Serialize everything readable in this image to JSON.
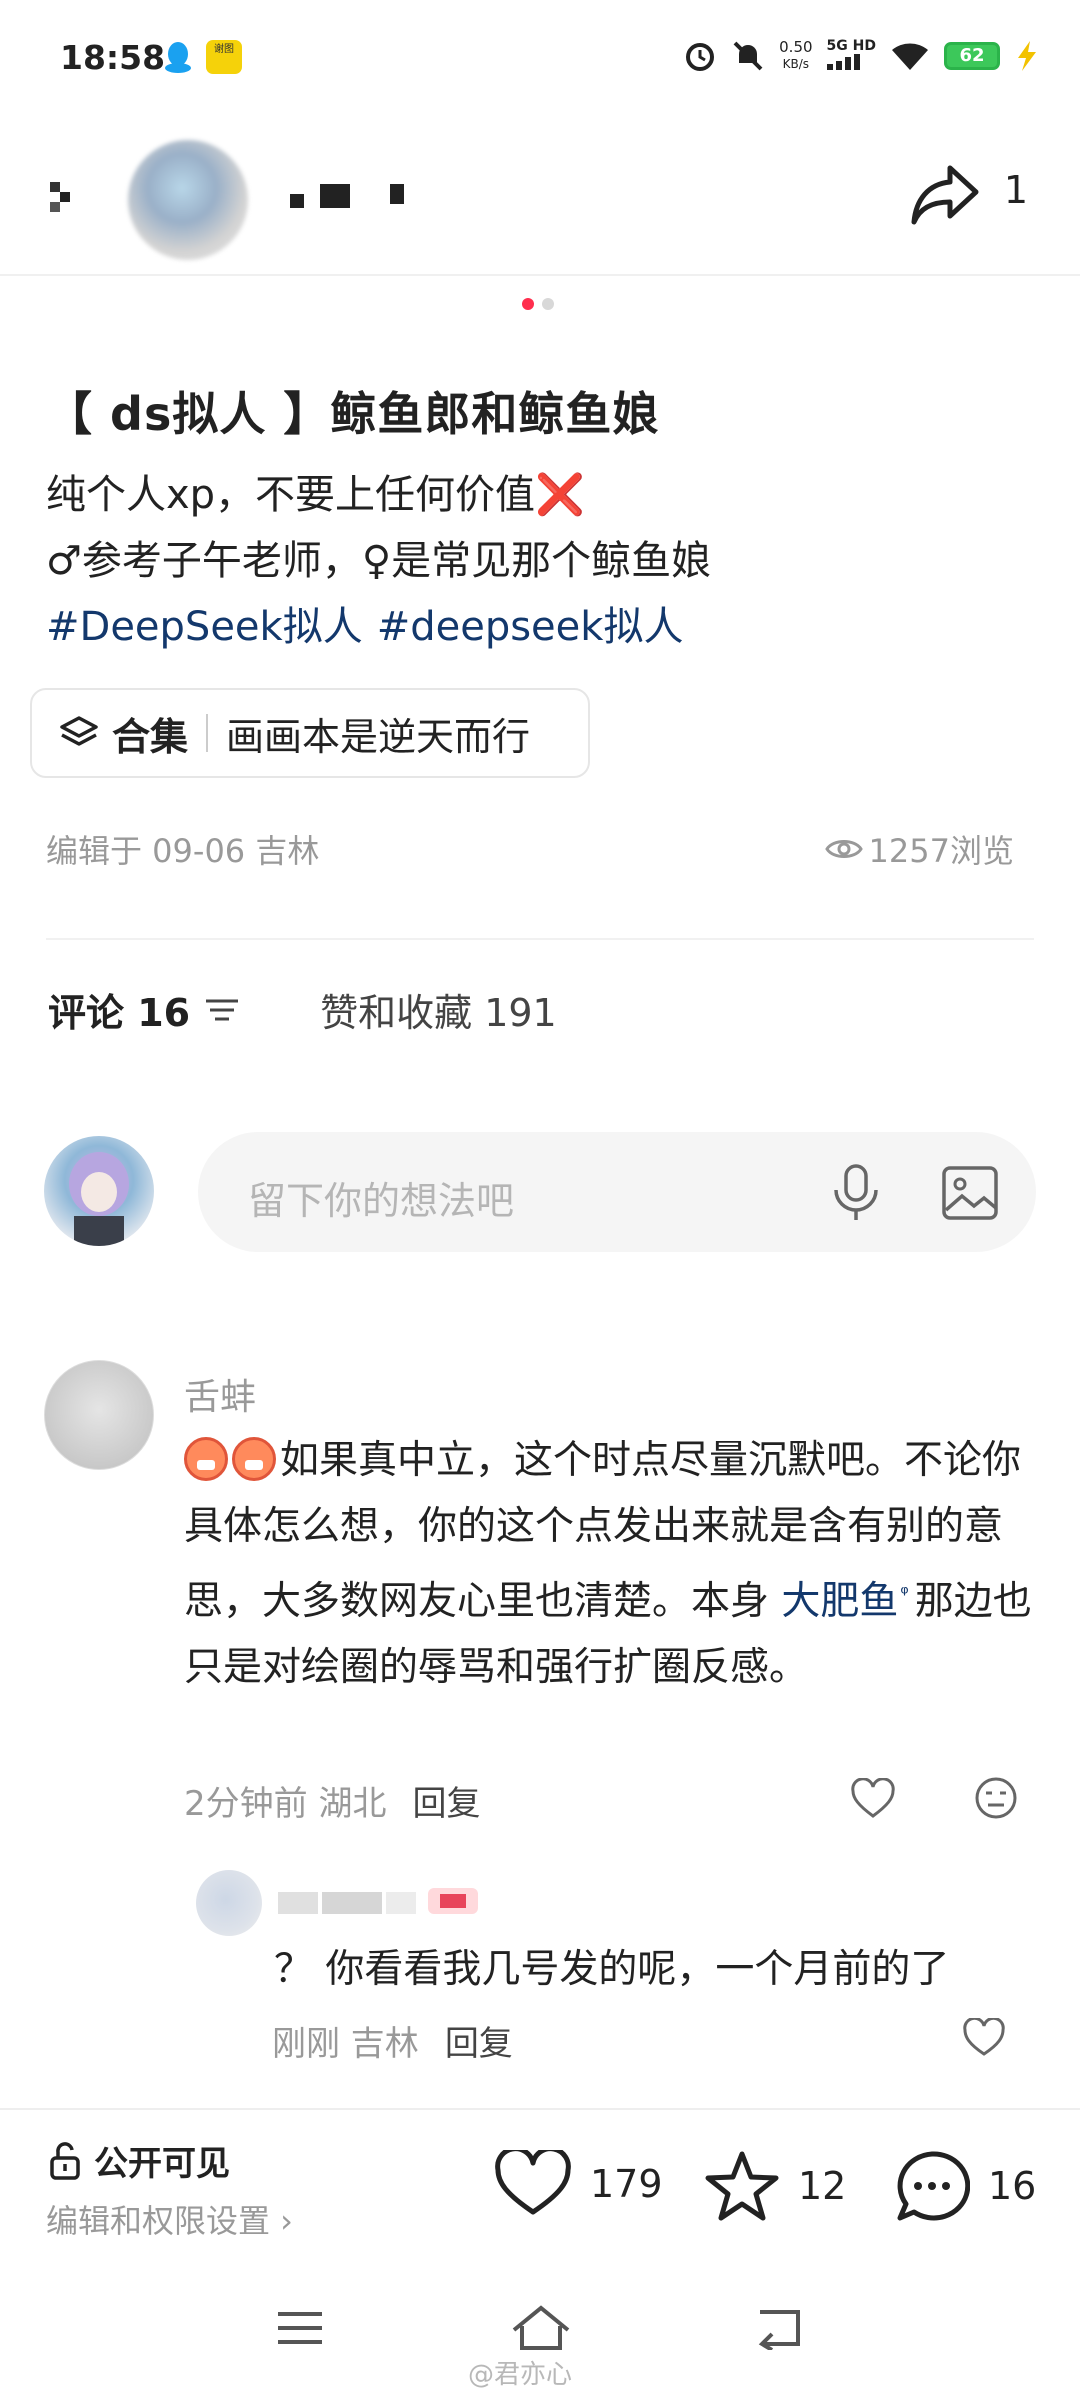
{
  "status_bar": {
    "time": "18:58",
    "app_badge": "谢图",
    "net_speed_value": "0.50",
    "net_speed_unit": "KB/s",
    "network": "5G HD",
    "battery": "62"
  },
  "header": {
    "share_count": "1"
  },
  "post": {
    "title": "【 ds拟人 】鲸鱼郎和鲸鱼娘",
    "body_line1": "纯个人xp，不要上任何价值",
    "body_line1_emoji": "❌",
    "body_line2": "♂参考子午老师，♀是常见那个鲸鱼娘",
    "tags": [
      "#DeepSeek拟人",
      "#deepseek拟人"
    ],
    "collection_label": "合集",
    "collection_name": "画画本是逆天而行",
    "edited": "编辑于 09-06 吉林",
    "views": "1257浏览"
  },
  "tabs": {
    "comments": "评论 16",
    "likes_favs": "赞和收藏 191"
  },
  "comment_input": {
    "placeholder": "留下你的想法吧"
  },
  "comment": {
    "user": "舌蚌",
    "text_part1": "如果真中立，这个时点尽量沉默吧。不论你具体怎么想，你的这个点发出来就是含有别的意思，大多数网友心里也清楚。本身 ",
    "highlight": "大肥鱼",
    "search_mark": "ᵠ",
    "text_part2": "那边也只是对绘圈的辱骂和强行扩圈反感。",
    "time_loc": "2分钟前 湖北",
    "reply": "回复"
  },
  "reply": {
    "text": "？ 你看看我几号发的呢，一个月前的了",
    "time_loc": "刚刚 吉林",
    "reply": "回复"
  },
  "bottom_bar": {
    "visibility": "公开可见",
    "permissions": "编辑和权限设置 ›",
    "likes": "179",
    "stars": "12",
    "comments": "16"
  },
  "watermark": "@君亦心",
  "colors": {
    "accent": "#ff2e4d",
    "link": "#13386c",
    "muted": "#999999"
  }
}
